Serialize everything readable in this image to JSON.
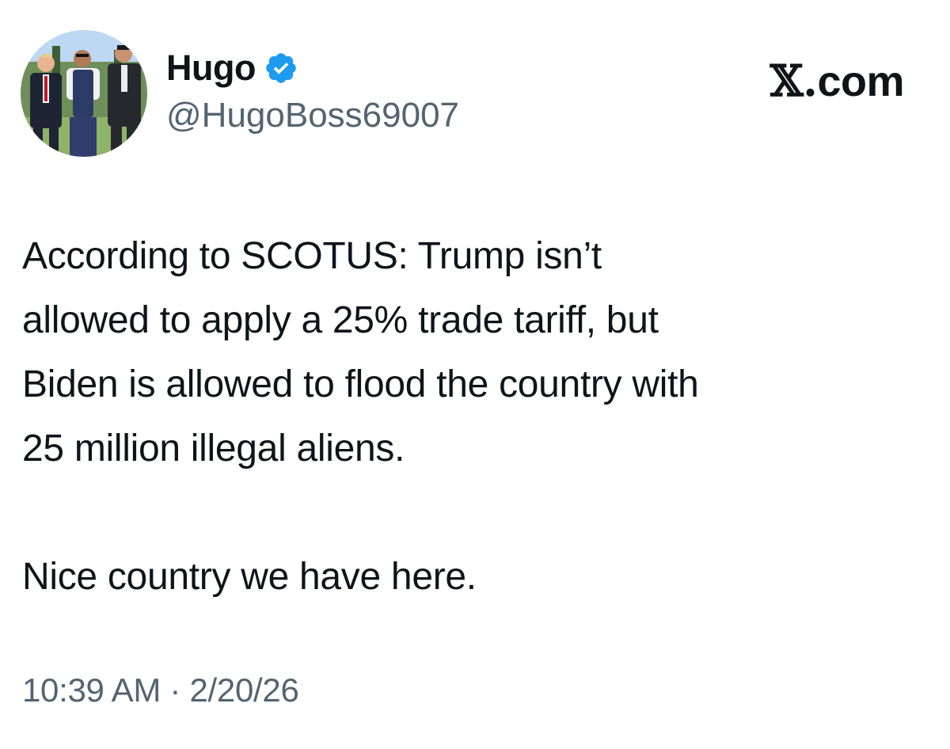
{
  "author": {
    "display_name": "Hugo",
    "handle": "@HugoBoss69007",
    "verified_icon": "verified-badge-icon",
    "badge_color": "#1d9bf0"
  },
  "site": {
    "logo_text": "com",
    "logo_prefix": "𝕏."
  },
  "tweet": {
    "line1": "According to SCOTUS: Trump isn’t",
    "line2": "allowed to apply a 25% trade tariff, but",
    "line3": "Biden is allowed to flood the country with",
    "line4": "25 million illegal aliens.",
    "line5": "Nice country we have here."
  },
  "meta": {
    "timestamp": "10:39 AM · 2/20/26"
  },
  "colors": {
    "text": "#0f1419",
    "muted": "#536471",
    "accent": "#1d9bf0"
  }
}
